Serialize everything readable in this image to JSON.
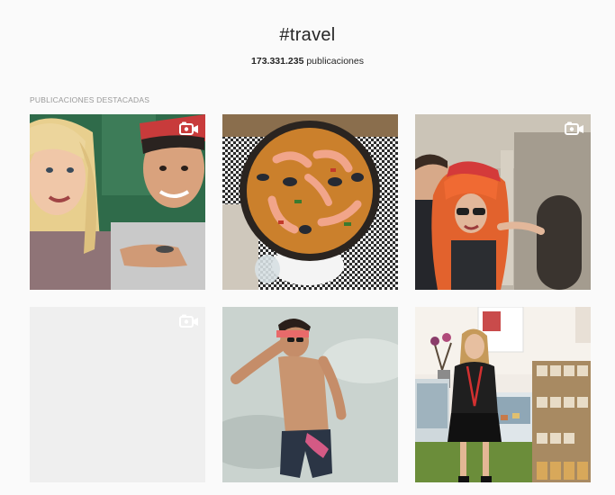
{
  "hashtag": {
    "title": "#travel"
  },
  "stats": {
    "count": "173.331.235",
    "label": "publicaciones"
  },
  "section": {
    "title": "PUBLICACIONES DESTACADAS"
  },
  "colors": {
    "background": "#fafafa",
    "section_title": "#999999",
    "placeholder_tile": "#efefef"
  },
  "posts": [
    {
      "type": "video",
      "icon": "video-camera-icon"
    },
    {
      "type": "photo"
    },
    {
      "type": "video",
      "icon": "video-camera-icon"
    },
    {
      "type": "video",
      "icon": "video-camera-icon"
    },
    {
      "type": "photo"
    },
    {
      "type": "photo"
    }
  ]
}
